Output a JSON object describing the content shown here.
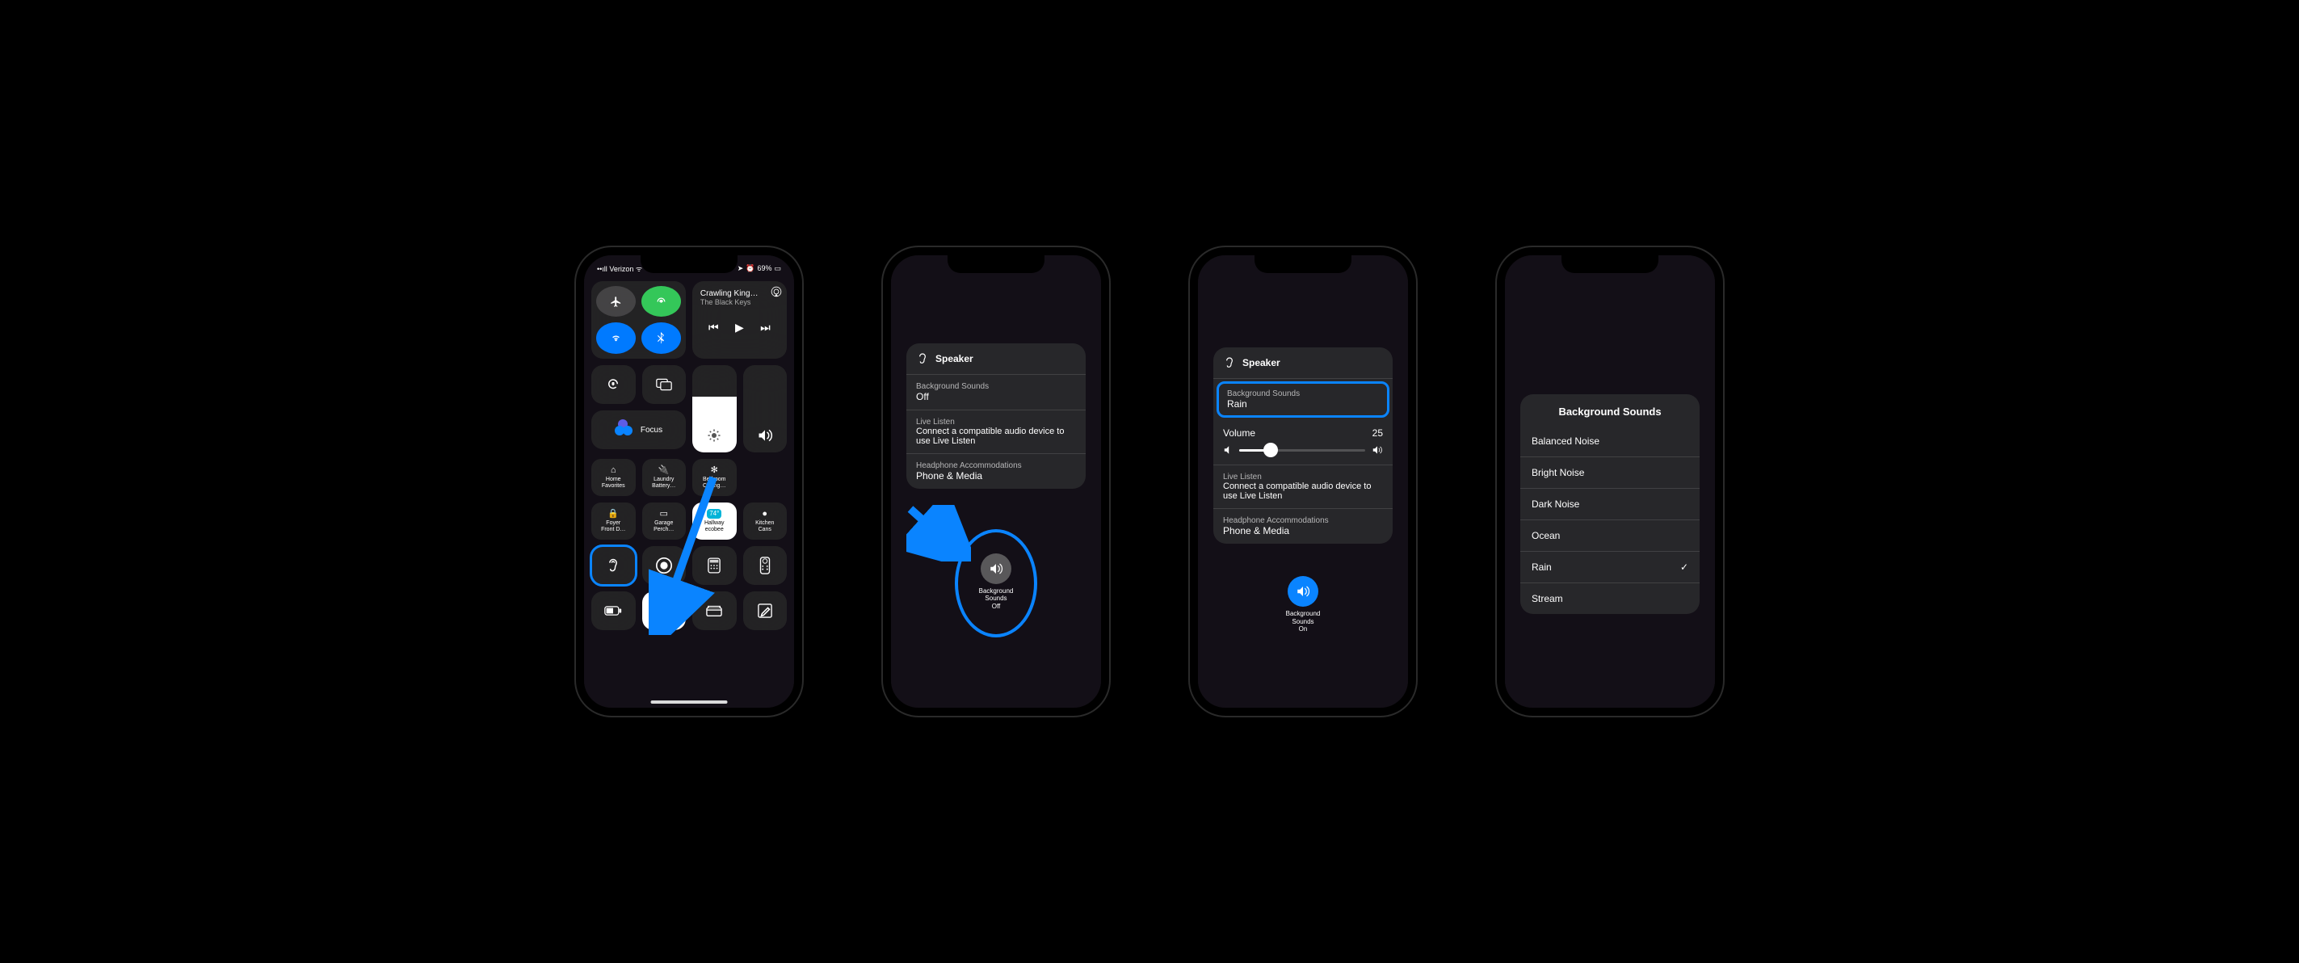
{
  "phone1": {
    "carrier": "Verizon",
    "battery": "69%",
    "nowPlaying": {
      "title": "Crawling King…",
      "artist": "The Black Keys"
    },
    "focusLabel": "Focus",
    "homeTiles": [
      [
        "Home",
        "Favorites"
      ],
      [
        "Laundry",
        "Battery…"
      ],
      [
        "Bedroom",
        "Ceiling…"
      ],
      [
        "Foyer",
        "Front D…"
      ],
      [
        "Garage",
        "Perch…"
      ],
      [
        "Hallway",
        "ecobee"
      ],
      [
        "Kitchen",
        "Cans"
      ]
    ]
  },
  "phone2": {
    "speaker": "Speaker",
    "bgLabel": "Background Sounds",
    "bgValue": "Off",
    "liveListen": "Live Listen",
    "liveSub": "Connect a compatible audio device to use Live Listen",
    "hpLabel": "Headphone Accommodations",
    "hpValue": "Phone & Media",
    "btnLabel1": "Background",
    "btnLabel2": "Sounds",
    "btnState": "Off"
  },
  "phone3": {
    "speaker": "Speaker",
    "bgLabel": "Background Sounds",
    "bgValue": "Rain",
    "volLabel": "Volume",
    "volValue": "25",
    "volPercent": 25,
    "liveListen": "Live Listen",
    "liveSub": "Connect a compatible audio device to use Live Listen",
    "hpLabel": "Headphone Accommodations",
    "hpValue": "Phone & Media",
    "btnLabel1": "Background",
    "btnLabel2": "Sounds",
    "btnState": "On"
  },
  "phone4": {
    "title": "Background Sounds",
    "options": [
      "Balanced Noise",
      "Bright Noise",
      "Dark Noise",
      "Ocean",
      "Rain",
      "Stream"
    ],
    "selectedIndex": 4
  }
}
